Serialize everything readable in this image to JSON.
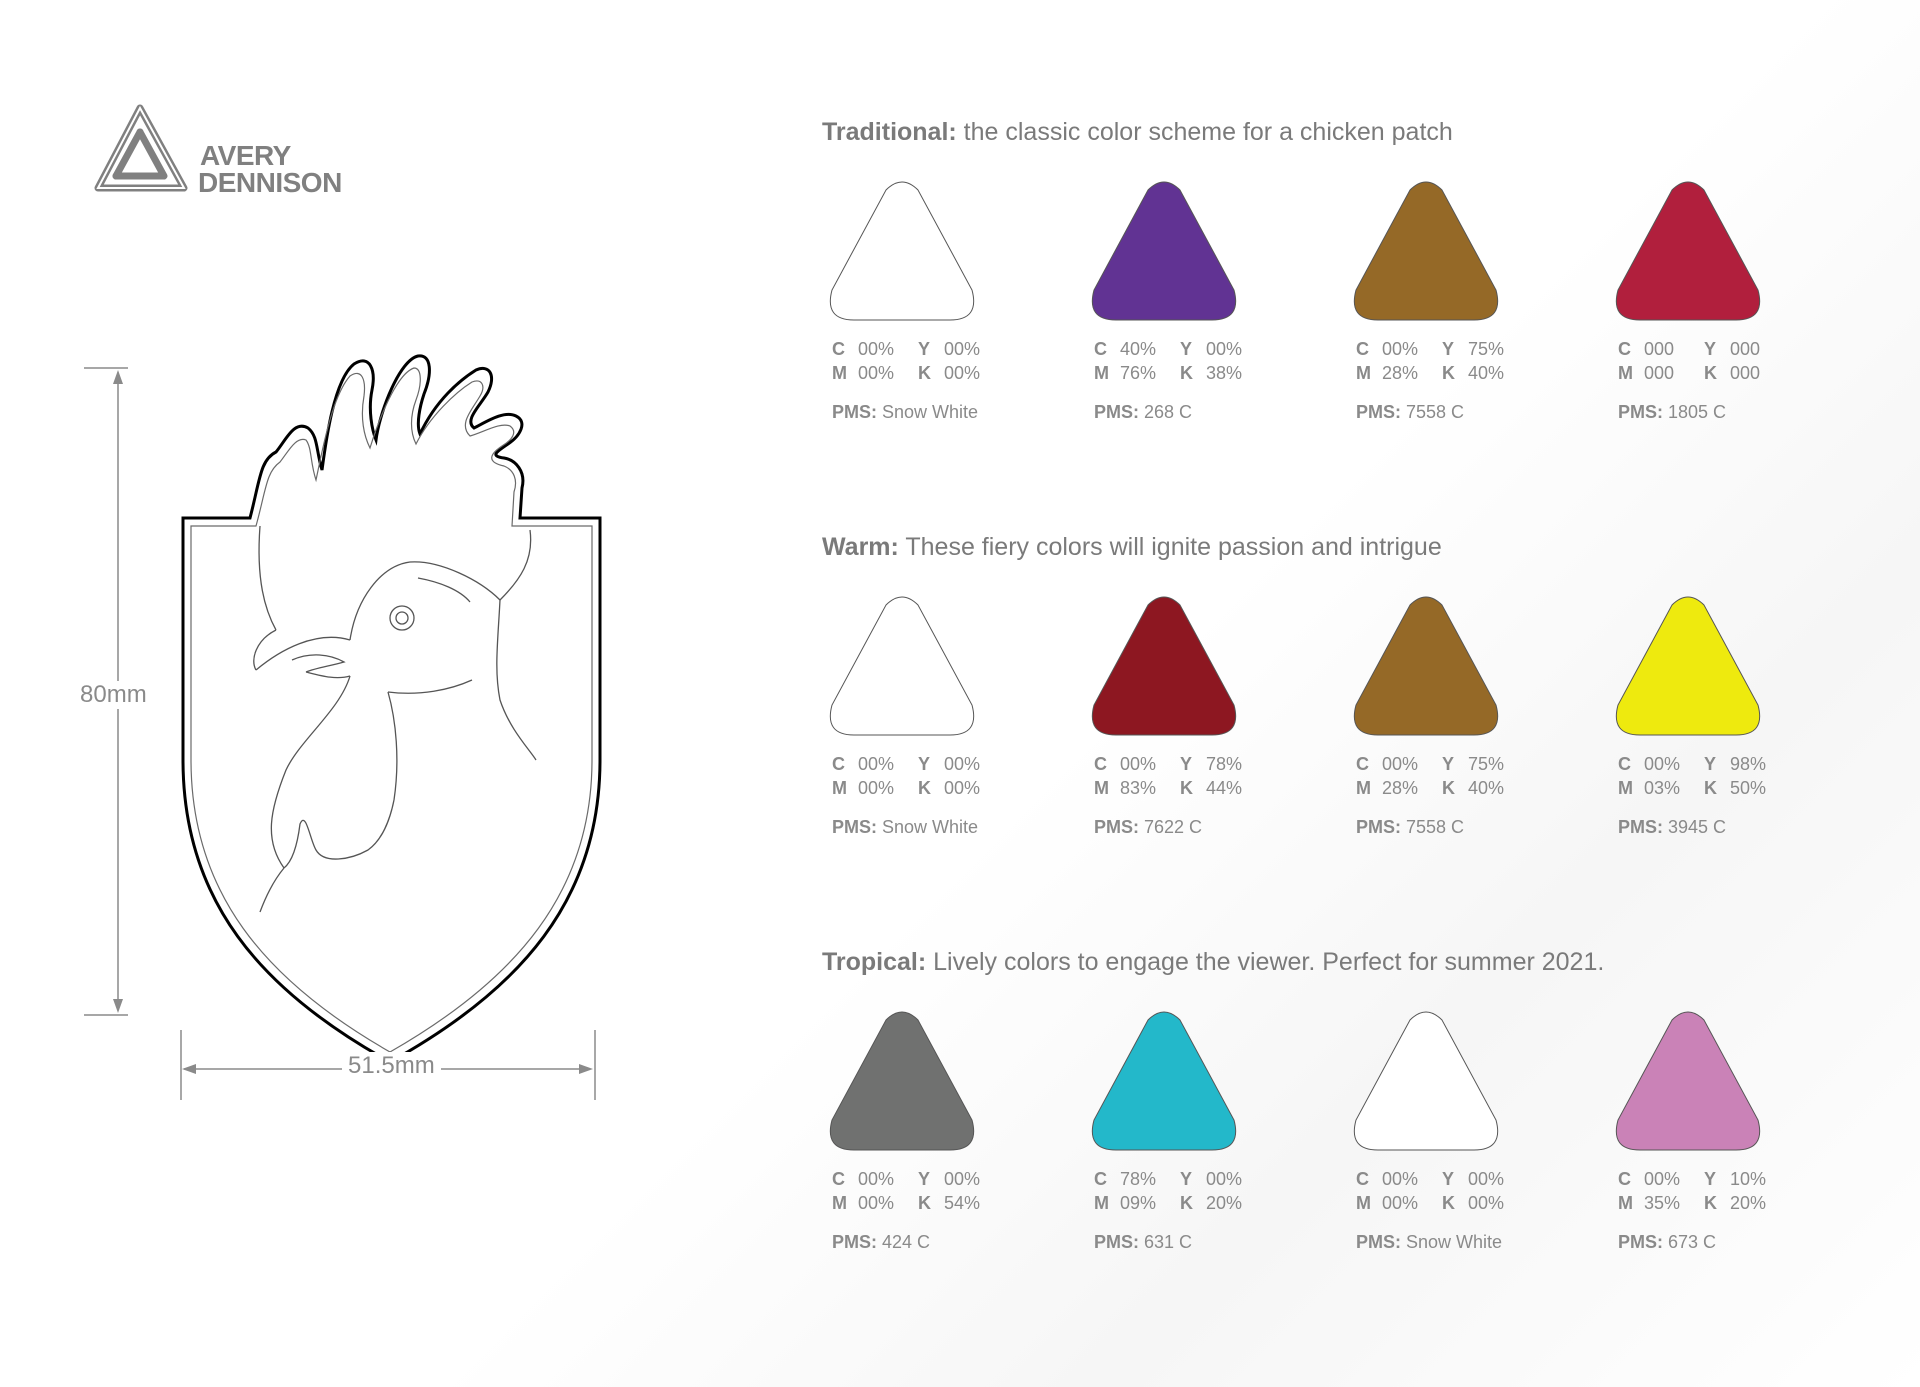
{
  "brand": {
    "line1": "AVERY",
    "line2": "DENNISON",
    "logo_icon": "avery-dennison-triangle-logo",
    "color": "#808080"
  },
  "badge": {
    "height_label": "80mm",
    "width_label": "51.5mm",
    "illustration": "rooster-head-shield-outline"
  },
  "palettes": [
    {
      "name": "Traditional:",
      "description": " the classic color scheme for a chicken patch",
      "swatches": [
        {
          "color": "#ffffff",
          "c": "00%",
          "m": "00%",
          "y": "00%",
          "k": "00%",
          "pms_label": "PMS:",
          "pms": "Snow White"
        },
        {
          "color": "#613393",
          "c": "40%",
          "m": "76%",
          "y": "00%",
          "k": "38%",
          "pms_label": "PMS:",
          "pms": "268 C"
        },
        {
          "color": "#956927",
          "c": "00%",
          "m": "28%",
          "y": "75%",
          "k": "40%",
          "pms_label": "PMS:",
          "pms": "7558 C"
        },
        {
          "color": "#b11f3d",
          "c": "000",
          "m": "000",
          "y": "000",
          "k": "000",
          "pms_label": "PMS:",
          "pms": "1805 C"
        }
      ]
    },
    {
      "name": "Warm:",
      "description": "These fiery colors will ignite passion and intrigue",
      "swatches": [
        {
          "color": "#ffffff",
          "c": "00%",
          "m": "00%",
          "y": "00%",
          "k": "00%",
          "pms_label": "PMS:",
          "pms": "Snow White"
        },
        {
          "color": "#8d1721",
          "c": "00%",
          "m": "83%",
          "y": "78%",
          "k": "44%",
          "pms_label": "PMS:",
          "pms": "7622 C"
        },
        {
          "color": "#956927",
          "c": "00%",
          "m": "28%",
          "y": "75%",
          "k": "40%",
          "pms_label": "PMS:",
          "pms": "7558 C"
        },
        {
          "color": "#eeea0e",
          "c": "00%",
          "m": "03%",
          "y": "98%",
          "k": "50%",
          "pms_label": "PMS:",
          "pms": "3945 C"
        }
      ]
    },
    {
      "name": "Tropical:",
      "description": "Lively colors to engage the viewer. Perfect for summer 2021.",
      "swatches": [
        {
          "color": "#707170",
          "c": "00%",
          "m": "00%",
          "y": "00%",
          "k": "54%",
          "pms_label": "PMS:",
          "pms": " 424 C"
        },
        {
          "color": "#23b8ca",
          "c": "78%",
          "m": "09%",
          "y": "00%",
          "k": "20%",
          "pms_label": "PMS:",
          "pms": "631 C"
        },
        {
          "color": "#ffffff",
          "c": "00%",
          "m": "00%",
          "y": "00%",
          "k": "00%",
          "pms_label": "PMS:",
          "pms": "Snow White"
        },
        {
          "color": "#ca82b7",
          "c": "00%",
          "m": "35%",
          "y": "10%",
          "k": "20%",
          "pms_label": "PMS:",
          "pms": "673 C"
        }
      ]
    }
  ]
}
